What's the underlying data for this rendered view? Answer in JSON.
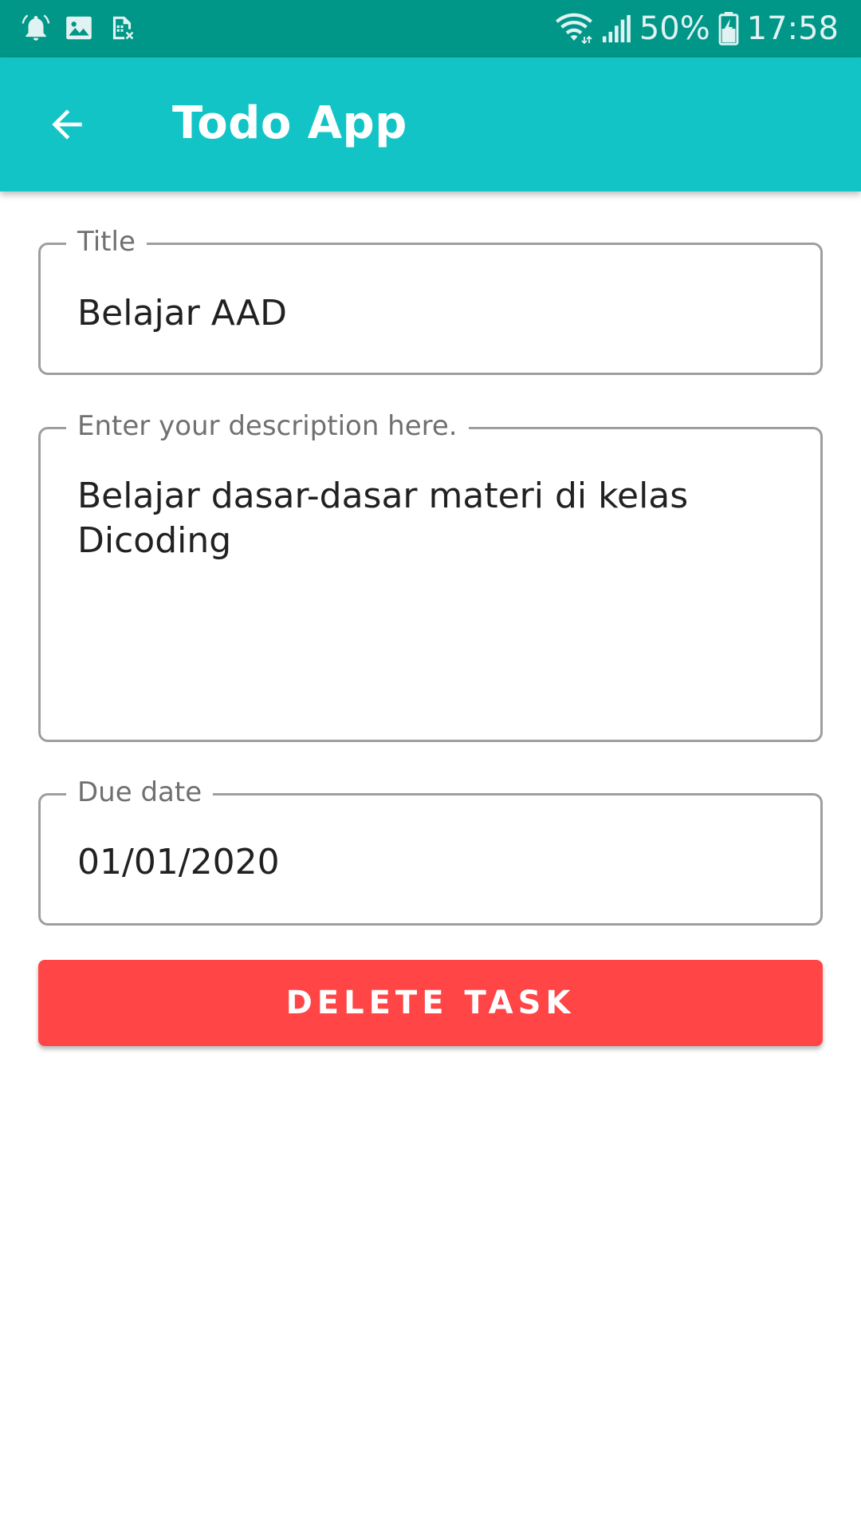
{
  "status_bar": {
    "icons_left": [
      "alarm-bell-icon",
      "image-icon",
      "sim-card-off-icon"
    ],
    "wifi_icon": "wifi-icon",
    "signal_icon": "cell-signal-icon",
    "battery_percent": "50%",
    "battery_icon": "battery-charging-icon",
    "time": "17:58",
    "background_color": "#009688"
  },
  "app_bar": {
    "back_icon": "arrow-back-icon",
    "title": "Todo App",
    "background_color": "#13c4c7"
  },
  "form": {
    "title_field": {
      "label": "Title",
      "value": "Belajar AAD"
    },
    "description_field": {
      "label": "Enter your description here.",
      "value_line1": "Belajar dasar-dasar materi di kelas",
      "value_line2": "Dicoding"
    },
    "due_date_field": {
      "label": "Due date",
      "value": "01/01/2020"
    },
    "delete_button": {
      "label": "DELETE TASK",
      "color": "#ff4545"
    }
  }
}
